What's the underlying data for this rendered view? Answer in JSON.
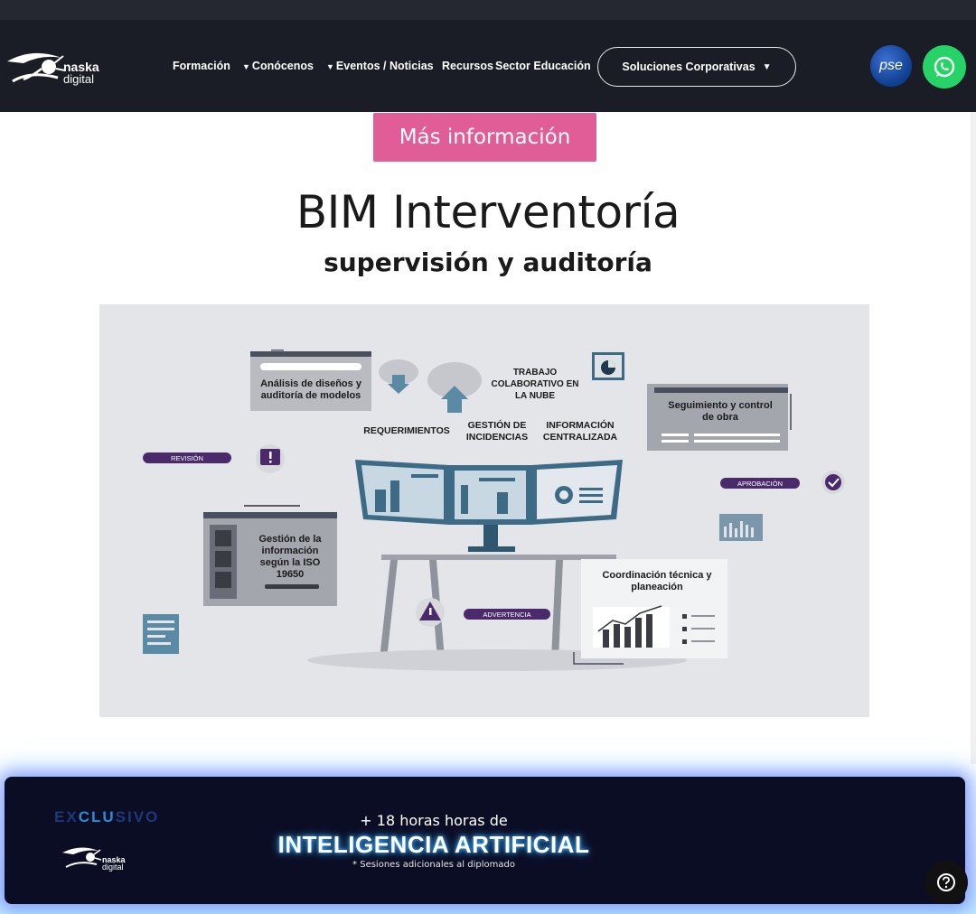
{
  "nav": {
    "logo": {
      "line1": "naska",
      "line2": "digital"
    },
    "items": [
      "Formación",
      "Conócenos",
      "Eventos / Noticias",
      "Recursos",
      "Sector Educación"
    ],
    "corporate_button": "Soluciones Corporativas",
    "pse_label": "pse",
    "whatsapp_icon": "whatsapp-icon"
  },
  "hero": {
    "more_button": "Más información",
    "title": "BIM Interventoría",
    "subtitle": "supervisión y auditoría"
  },
  "illustration": {
    "labels": {
      "analysis": "Análisis de diseños y auditoría de modelos",
      "cloud": "TRABAJO COLABORATIVO EN LA NUBE",
      "requirements": "REQUERIMIENTOS",
      "incidents": "GESTIÓN DE INCIDENCIAS",
      "centralized": "INFORMACIÓN CENTRALIZADA",
      "tracking": "Seguimiento y control de obra",
      "info_mgmt": "Gestión de la información según la ISO 19650",
      "coordination": "Coordinación técnica y planeación"
    },
    "pills": {
      "review": "REVISIÓN",
      "approval": "APROBACIÓN",
      "warning": "ADVERTENCIA"
    },
    "colors": {
      "purple": "#4b2a6b",
      "teal": "#3d6a84",
      "gray": "#a4a6ad"
    }
  },
  "banner": {
    "exclusive_a": "EX",
    "exclusive_b": "CLU",
    "exclusive_c": "SIVO",
    "logo_line1": "naska",
    "logo_line2": "digital",
    "small": "+ 18 horas horas de",
    "big": "INTELIGENCIA ARTIFICIAL",
    "note": "* Sesiones adicionales al diplomado"
  },
  "help_icon": "help-icon",
  "colors": {
    "nav_bg": "#1a1d25",
    "accent_pink": "#e05d98",
    "whatsapp": "#25d366",
    "banner_bg": "#0b0d24"
  }
}
